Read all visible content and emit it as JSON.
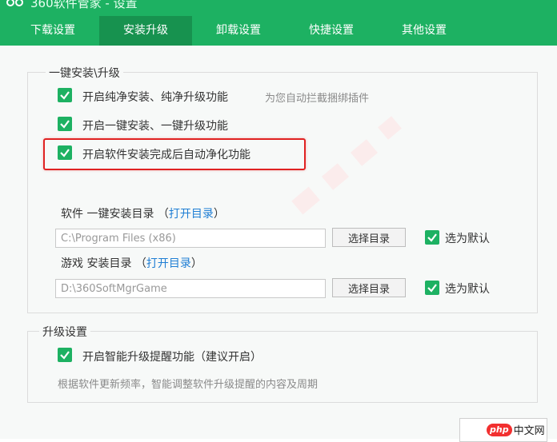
{
  "window": {
    "title": "360软件管家 - 设置"
  },
  "tabs": [
    {
      "label": "下载设置",
      "active": false
    },
    {
      "label": "安装升级",
      "active": true
    },
    {
      "label": "卸载设置",
      "active": false
    },
    {
      "label": "快捷设置",
      "active": false
    },
    {
      "label": "其他设置",
      "active": false
    }
  ],
  "install_group": {
    "title": "一键安装\\升级",
    "options": [
      {
        "label": "开启纯净安装、纯净升级功能",
        "checked": true,
        "hint": "为您自动拦截捆绑插件"
      },
      {
        "label": "开启一键安装、一键升级功能",
        "checked": true
      },
      {
        "label": "开启软件安装完成后自动净化功能",
        "checked": true
      }
    ],
    "software_dir": {
      "label": "软件 一键安装目录 （",
      "link": "打开目录",
      "close": "）",
      "path": "C:\\Program Files (x86)",
      "choose_button": "选择目录",
      "default_label": "选为默认",
      "default_checked": true
    },
    "game_dir": {
      "label": "游戏 安装目录 （",
      "link": "打开目录",
      "close": "）",
      "path": "D:\\360SoftMgrGame",
      "choose_button": "选择目录",
      "default_label": "选为默认",
      "default_checked": true
    }
  },
  "upgrade_group": {
    "title": "升级设置",
    "option": {
      "label": "开启智能升级提醒功能（建议开启）",
      "checked": true
    },
    "description": "根据软件更新频率，智能调整软件升级提醒的内容及周期"
  },
  "badge": {
    "logo": "php",
    "text": "中文网"
  },
  "colors": {
    "accent": "#1db162",
    "accent_dark": "#17924f",
    "link": "#1f7ed4",
    "highlight": "#e02222"
  }
}
